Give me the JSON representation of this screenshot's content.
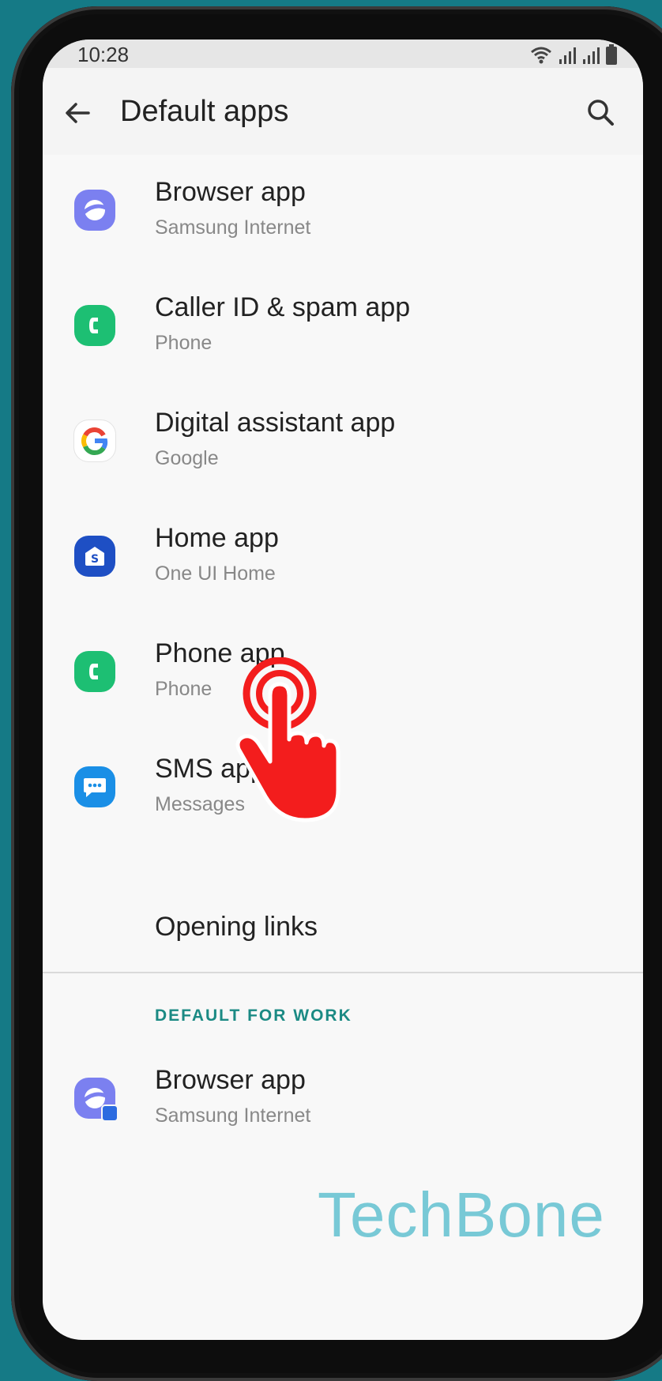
{
  "status_bar": {
    "time": "10:28",
    "icons": [
      "wifi-icon",
      "signal-icon",
      "signal-icon",
      "battery-icon"
    ]
  },
  "app_bar": {
    "title": "Default apps",
    "back_icon": "arrow-left-icon",
    "search_icon": "search-icon"
  },
  "items": [
    {
      "title": "Browser app",
      "subtitle": "Samsung Internet",
      "icon": "samsung-internet-icon",
      "color": "#7b80f0"
    },
    {
      "title": "Caller ID & spam app",
      "subtitle": "Phone",
      "icon": "phone-app-icon",
      "color": "#1dbf73"
    },
    {
      "title": "Digital assistant app",
      "subtitle": "Google",
      "icon": "google-icon",
      "color": "#ffffff"
    },
    {
      "title": "Home app",
      "subtitle": "One UI Home",
      "icon": "one-ui-home-icon",
      "color": "#1e4fc4"
    },
    {
      "title": "Phone app",
      "subtitle": "Phone",
      "icon": "phone-app-icon",
      "color": "#1dbf73"
    },
    {
      "title": "SMS app",
      "subtitle": "Messages",
      "icon": "messages-icon",
      "color": "#1a8fe6"
    }
  ],
  "opening_links": "Opening links",
  "work_section": {
    "header": "DEFAULT FOR WORK",
    "item": {
      "title": "Browser app",
      "subtitle": "Samsung Internet",
      "icon": "samsung-internet-work-icon"
    }
  },
  "watermark": "TechBone",
  "overlay": {
    "icon": "tap-hand-icon",
    "color": "#f31d1d"
  }
}
